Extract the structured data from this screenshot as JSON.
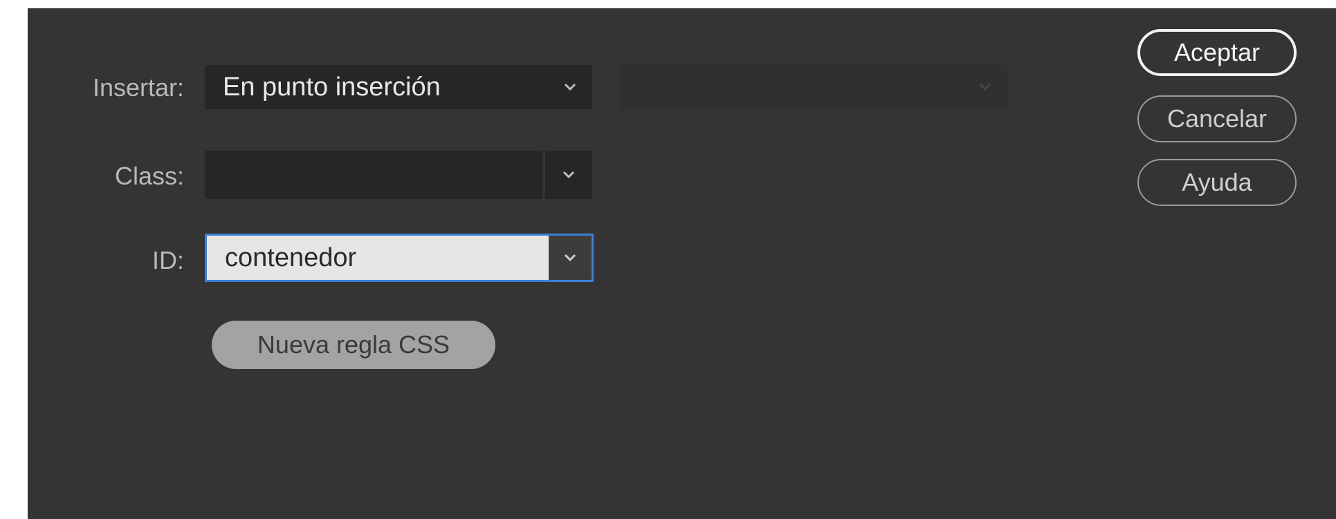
{
  "form": {
    "insert_label": "Insertar:",
    "insert_value": "En punto inserción",
    "secondary_value": "",
    "class_label": "Class:",
    "class_value": "",
    "id_label": "ID:",
    "id_value": "contenedor",
    "new_css_rule_label": "Nueva regla CSS"
  },
  "buttons": {
    "ok_label": "Aceptar",
    "cancel_label": "Cancelar",
    "help_label": "Ayuda"
  },
  "colors": {
    "dialog_bg": "#343434",
    "field_bg": "#262626",
    "focus_border": "#3d7fd6"
  },
  "icons": {
    "dropdown": "chevron-down-icon"
  }
}
